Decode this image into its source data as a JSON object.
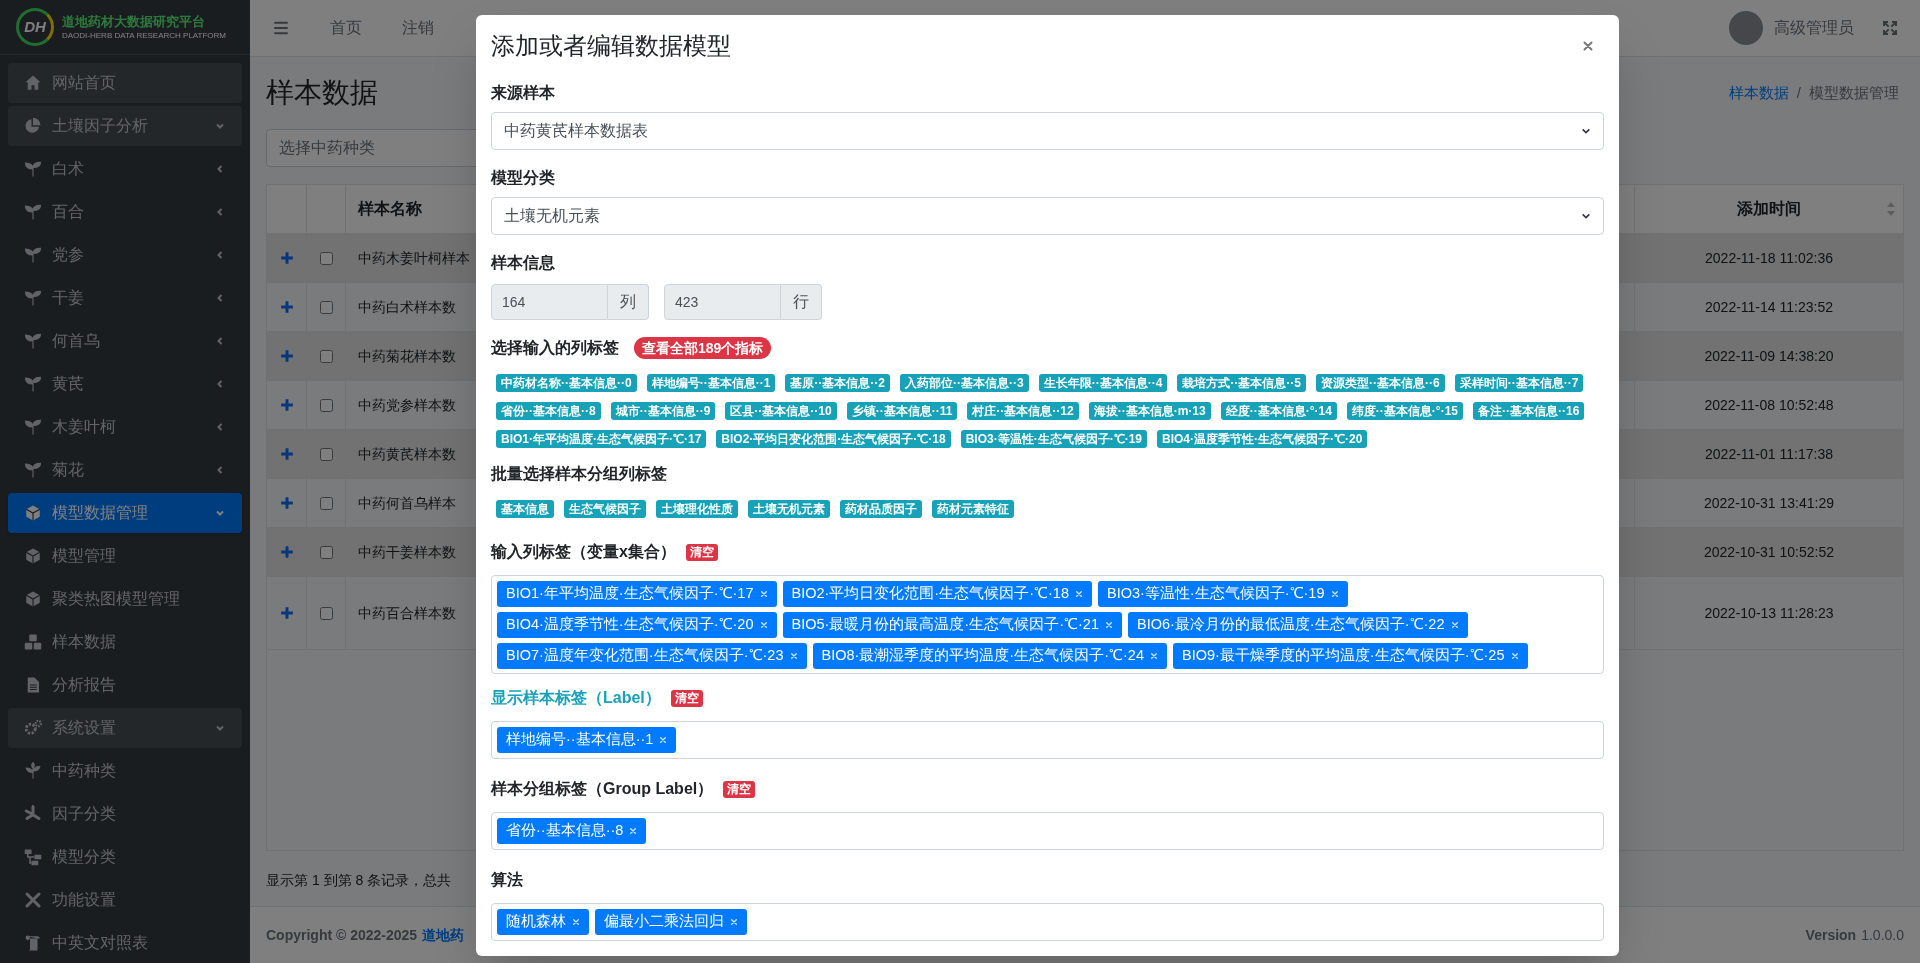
{
  "sidebar": {
    "logo_text": "DH",
    "brand_title": "道地药材大数据研究平台",
    "brand_subtitle": "DAODI-HERB DATA RESEARCH PLATFORM",
    "items": [
      {
        "label": "网站首页",
        "kind": "link",
        "selected": false
      },
      {
        "label": "土壤因子分析",
        "kind": "group",
        "selected": false,
        "expanded": true,
        "children": [
          {
            "label": "白术",
            "kind": "group",
            "expanded": false
          },
          {
            "label": "百合",
            "kind": "group",
            "expanded": false
          },
          {
            "label": "党参",
            "kind": "group",
            "expanded": false
          },
          {
            "label": "干姜",
            "kind": "group",
            "expanded": false
          },
          {
            "label": "何首乌",
            "kind": "group",
            "expanded": false
          },
          {
            "label": "黄芪",
            "kind": "group",
            "expanded": false
          },
          {
            "label": "木姜叶柯",
            "kind": "group",
            "expanded": false
          },
          {
            "label": "菊花",
            "kind": "group",
            "expanded": false
          }
        ]
      },
      {
        "label": "模型数据管理",
        "kind": "group",
        "selected": true,
        "expanded": true,
        "children": [
          {
            "label": "模型管理",
            "kind": "link"
          },
          {
            "label": "聚类热图模型管理",
            "kind": "link"
          },
          {
            "label": "样本数据",
            "kind": "link"
          },
          {
            "label": "分析报告",
            "kind": "link"
          }
        ]
      },
      {
        "label": "系统设置",
        "kind": "group",
        "selected": false,
        "expanded": true,
        "children": [
          {
            "label": "中药种类",
            "kind": "link"
          },
          {
            "label": "因子分类",
            "kind": "link"
          },
          {
            "label": "模型分类",
            "kind": "link"
          },
          {
            "label": "功能设置",
            "kind": "link"
          },
          {
            "label": "中英文对照表",
            "kind": "link"
          }
        ]
      }
    ]
  },
  "navbar": {
    "links": [
      "首页",
      "注销"
    ],
    "user": "高级管理员"
  },
  "page": {
    "title": "样本数据",
    "breadcrumb": [
      "样本数据",
      "模型数据管理"
    ],
    "breadcrumb_separator": "/",
    "filter_placeholder": "选择中药种类",
    "table": {
      "columns": [
        "样本名称",
        "添加时间"
      ],
      "rows": [
        {
          "name": "中药木姜叶柯样本",
          "added": "2022-11-18 11:02:36",
          "checked": false
        },
        {
          "name": "中药白术样本数",
          "added": "2022-11-14 11:23:52",
          "checked": false
        },
        {
          "name": "中药菊花样本数",
          "added": "2022-11-09 14:38:20",
          "checked": false
        },
        {
          "name": "中药党参样本数",
          "added": "2022-11-08 10:52:48",
          "checked": false
        },
        {
          "name": "中药黄芪样本数",
          "added": "2022-11-01 11:17:38",
          "checked": false
        },
        {
          "name": "中药何首乌样本",
          "added": "2022-10-31 13:41:29",
          "checked": false
        },
        {
          "name": "中药干姜样本数",
          "added": "2022-10-31 10:52:52",
          "checked": false
        },
        {
          "name": "中药百合样本数",
          "added": "2022-10-13 11:28:23",
          "checked": false
        }
      ]
    },
    "pagination_info": "显示第 1 到第 8 条记录，总共"
  },
  "footer": {
    "copyright": "Copyright © 2022-2025",
    "copyright_link": "道地药",
    "version_label": "Version",
    "version": "1.0.0.0"
  },
  "modal": {
    "title": "添加或者编辑数据模型",
    "source_sample": {
      "label": "来源样本",
      "value": "中药黄芪样本数据表"
    },
    "model_category": {
      "label": "模型分类",
      "value": "土壤无机元素"
    },
    "sample_info": {
      "label": "样本信息",
      "fields": [
        {
          "value": "164",
          "unit": "列"
        },
        {
          "value": "423",
          "unit": "行"
        }
      ]
    },
    "column_picker": {
      "label": "选择输入的列标签",
      "badge": "查看全部189个指标",
      "tags": [
        "中药材名称··基本信息··0",
        "样地编号··基本信息··1",
        "基原··基本信息··2",
        "入药部位··基本信息··3",
        "生长年限··基本信息··4",
        "栽培方式··基本信息··5",
        "资源类型··基本信息··6",
        "采样时间··基本信息··7",
        "省份··基本信息··8",
        "城市··基本信息··9",
        "区县··基本信息··10",
        "乡镇··基本信息··11",
        "村庄··基本信息··12",
        "海拔··基本信息·m·13",
        "经度··基本信息·°·14",
        "纬度··基本信息·°·15",
        "备注··基本信息··16",
        "BIO1·年平均温度·生态气候因子·℃·17",
        "BIO2·平均日变化范围·生态气候因子·℃·18",
        "BIO3·等温性·生态气候因子·℃·19",
        "BIO4·温度季节性·生态气候因子·℃·20"
      ]
    },
    "group_picker": {
      "label": "批量选择样本分组列标签",
      "tags": [
        "基本信息",
        "生态气候因子",
        "土壤理化性质",
        "土壤无机元素",
        "药材品质因子",
        "药材元素特征"
      ]
    },
    "tag_fields": [
      {
        "label": "输入列标签（变量x集合）",
        "clear": "清空",
        "highlighted": false,
        "tags": [
          "BIO1·年平均温度·生态气候因子·℃·17",
          "BIO2·平均日变化范围·生态气候因子·℃·18",
          "BIO3·等温性·生态气候因子·℃·19",
          "BIO4·温度季节性·生态气候因子·℃·20",
          "BIO5·最暖月份的最高温度·生态气候因子·℃·21",
          "BIO6·最冷月份的最低温度·生态气候因子·℃·22",
          "BIO7·温度年变化范围·生态气候因子·℃·23",
          "BIO8·最潮湿季度的平均温度·生态气候因子·℃·24",
          "BIO9·最干燥季度的平均温度·生态气候因子·℃·25"
        ]
      },
      {
        "label": "显示样本标签（Label）",
        "clear": "清空",
        "highlighted": true,
        "tags": [
          "样地编号··基本信息··1"
        ]
      },
      {
        "label": "样本分组标签（Group Label）",
        "clear": "清空",
        "highlighted": false,
        "tags": [
          "省份··基本信息··8"
        ]
      },
      {
        "label": "算法",
        "highlighted": false,
        "tags": [
          "随机森林",
          "偏最小二乘法回归"
        ]
      }
    ]
  }
}
